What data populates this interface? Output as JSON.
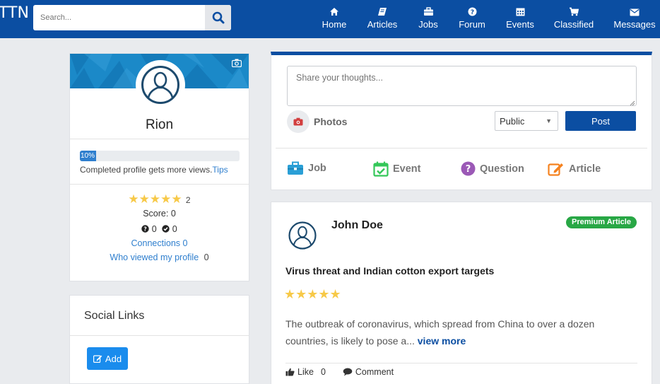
{
  "header": {
    "logo_text": "TTN",
    "search_placeholder": "Search...",
    "nav": [
      {
        "label": "Home",
        "icon": "home-icon"
      },
      {
        "label": "Articles",
        "icon": "book-icon"
      },
      {
        "label": "Jobs",
        "icon": "briefcase-icon"
      },
      {
        "label": "Forum",
        "icon": "question-circle-icon"
      },
      {
        "label": "Events",
        "icon": "calendar-icon"
      },
      {
        "label": "Classified",
        "icon": "cart-icon"
      },
      {
        "label": "Messages",
        "icon": "envelope-icon"
      }
    ]
  },
  "profile": {
    "name": "Rion",
    "progress_label": "10%",
    "progress_value": 0.1,
    "progress_text": "Completed profile gets more views.",
    "tips_link": "Tips",
    "stars_display": "★★★★★",
    "rating_count": "2",
    "score_text": "Score: 0",
    "questions_count": "0",
    "answers_count": "0",
    "connections_label": "Connections",
    "connections_count": "0",
    "viewed_label": "Who viewed my profile",
    "viewed_count": "0"
  },
  "social": {
    "title": "Social Links",
    "add_label": "Add"
  },
  "composer": {
    "placeholder": "Share your thoughts...",
    "photos_label": "Photos",
    "visibility_value": "Public",
    "post_label": "Post",
    "types": [
      {
        "label": "Job",
        "icon": "briefcase-icon",
        "color": "#2a9fd6"
      },
      {
        "label": "Event",
        "icon": "calendar-check-icon",
        "color": "#34c759"
      },
      {
        "label": "Question",
        "icon": "question-circle-icon",
        "color": "#9b59b6"
      },
      {
        "label": "Article",
        "icon": "edit-icon",
        "color": "#f5821f"
      }
    ]
  },
  "article": {
    "author": "John Doe",
    "badge": "Premium Article",
    "title": "Virus threat and Indian cotton export targets",
    "stars_display": "★★★★★",
    "rating": 4.5,
    "body": "The outbreak of coronavirus, which spread from China to over a dozen countries, is likely to pose a...",
    "view_more": "view more",
    "like_label": "Like",
    "like_count": "0",
    "comment_label": "Comment"
  },
  "colors": {
    "brand": "#0b4ea2",
    "accent": "#2f7fce",
    "star": "#f7c948",
    "badge": "#28a745"
  }
}
